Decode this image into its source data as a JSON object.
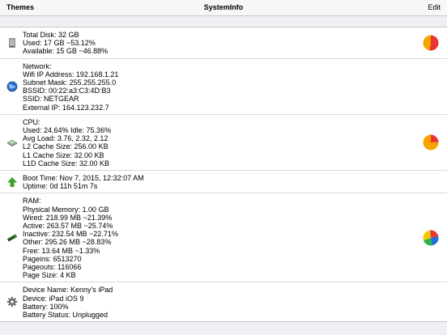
{
  "navbar": {
    "left_label": "Themes",
    "title": "SystemInfo",
    "right_label": "Edit"
  },
  "disk": {
    "icon": "hard-drive-icon",
    "lines": [
      "Total Disk: 32 GB",
      "Used: 17 GB ~53.12%",
      "Available: 15 GB ~46.88%"
    ],
    "pie": [
      53.12,
      46.88
    ],
    "colors": [
      "#e8352f",
      "#f7a400"
    ]
  },
  "network": {
    "icon": "globe-icon",
    "lines": [
      "Network:",
      "Wifi IP Address: 192.168.1.21",
      "Subnet Mask: 255.255.255.0",
      "BSSID: 00:22:a3:C3:4D:B3",
      "SSID: NETGEAR",
      "External IP: 164.123.232.7"
    ]
  },
  "cpu": {
    "icon": "cpu-chip-icon",
    "lines": [
      "CPU:",
      "Used: 24.64%  Idle: 75.36%",
      "Avg Load: 3.76, 2.32, 2.12",
      "L2 Cache Size: 256.00 KB",
      "L1 Cache Size: 32.00 KB",
      "L1D Cache Size: 32.00 KB"
    ],
    "pie": [
      24.64,
      75.36
    ],
    "colors": [
      "#e8352f",
      "#f7a400"
    ]
  },
  "boot": {
    "icon": "up-arrow-icon",
    "lines": [
      "Boot Time: Nov 7, 2015, 12:32:07 AM",
      "Uptime: 0d 11h 51m 7s"
    ]
  },
  "ram": {
    "icon": "memory-stick-icon",
    "lines": [
      "RAM:",
      "Physical Memory: 1.00 GB",
      "Wired: 218.99 MB ~21.39%",
      "Active: 263.57 MB ~25.74%",
      "Inactive: 232.54 MB ~22.71%",
      "Other: 295.26 MB ~28.83%",
      "Free: 13.64 MB ~1.33%",
      "Pageins: 6513270",
      "Pageouts: 116066",
      "Page Size: 4 KB"
    ],
    "pie": [
      21.39,
      25.74,
      22.71,
      28.83,
      1.33
    ],
    "colors": [
      "#e8352f",
      "#1f6fd6",
      "#2bb24c",
      "#f7c800",
      "#7d3cc4"
    ]
  },
  "device": {
    "icon": "gear-icon",
    "lines": [
      "Device Name: Kenny's iPad",
      "Device: iPad iOS 9",
      "Battery: 100%",
      "Battery Status: Unplugged"
    ]
  }
}
